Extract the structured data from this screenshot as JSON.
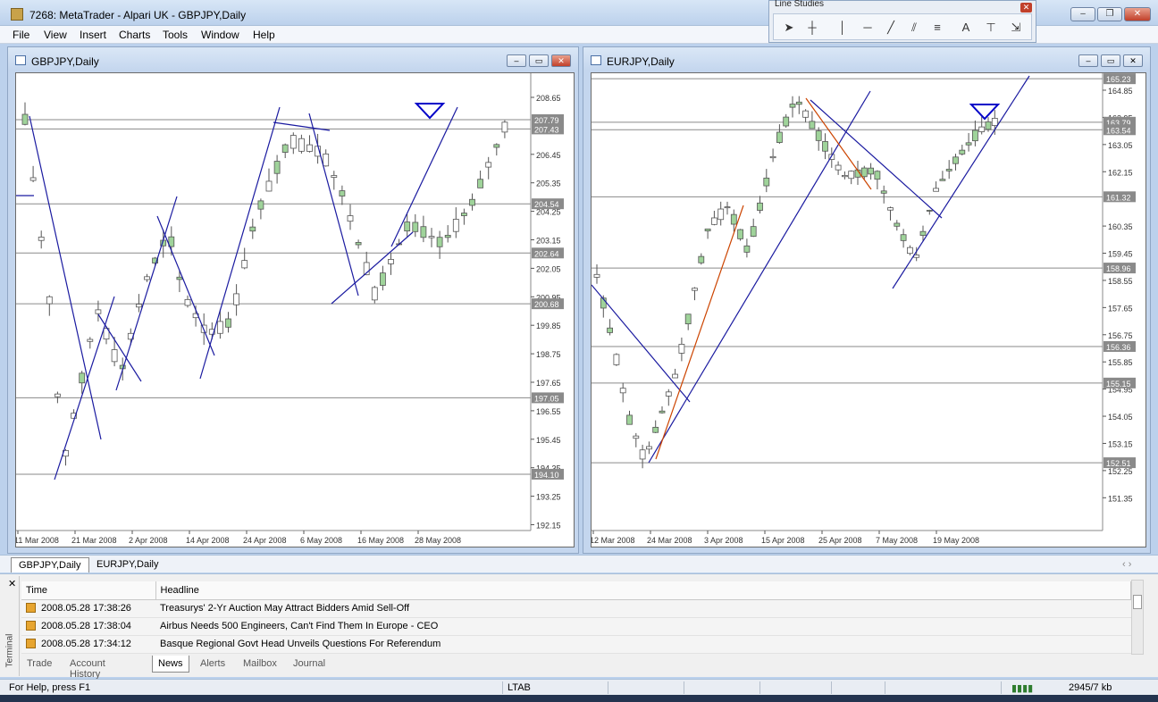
{
  "window": {
    "title": "7268: MetaTrader - Alpari UK - GBPJPY,Daily"
  },
  "menu": [
    "File",
    "View",
    "Insert",
    "Charts",
    "Tools",
    "Window",
    "Help"
  ],
  "line_studies": {
    "title": "Line Studies",
    "tools": [
      "cursor-icon",
      "crosshair-icon",
      "vertical-line-icon",
      "horizontal-line-icon",
      "trendline-icon",
      "fibonacci-icon",
      "channel-icon",
      "text-icon",
      "text-label-icon",
      "arrows-icon"
    ]
  },
  "charts": {
    "gbp": {
      "title": "GBPJPY,Daily",
      "price_labels": [
        "208.65",
        "206.45",
        "205.35",
        "204.25",
        "203.15",
        "202.05",
        "200.95",
        "199.85",
        "198.75",
        "197.65",
        "196.55",
        "195.45",
        "194.35",
        "193.25",
        "192.15"
      ],
      "hline_labels": [
        "207.79",
        "207.43",
        "204.54",
        "202.64",
        "200.68",
        "197.05",
        "194.10"
      ],
      "date_labels": [
        "11 Mar 2008",
        "21 Mar 2008",
        "2 Apr 2008",
        "14 Apr 2008",
        "24 Apr 2008",
        "6 May 2008",
        "16 May 2008",
        "28 May 2008"
      ]
    },
    "eur": {
      "title": "EURJPY,Daily",
      "price_labels": [
        "164.85",
        "163.95",
        "163.05",
        "162.15",
        "160.35",
        "159.45",
        "158.55",
        "157.65",
        "156.75",
        "155.85",
        "154.95",
        "154.05",
        "153.15",
        "152.25",
        "151.35"
      ],
      "hline_labels": [
        "165.23",
        "163.79",
        "163.54",
        "161.32",
        "158.96",
        "156.36",
        "155.15",
        "152.51"
      ],
      "date_labels": [
        "12 Mar 2008",
        "24 Mar 2008",
        "3 Apr 2008",
        "15 Apr 2008",
        "25 Apr 2008",
        "7 May 2008",
        "19 May 2008"
      ]
    }
  },
  "chart_tabs": [
    "GBPJPY,Daily",
    "EURJPY,Daily"
  ],
  "terminal": {
    "side_label": "Terminal",
    "columns": [
      "Time",
      "Headline"
    ],
    "rows": [
      {
        "time": "2008.05.28 17:38:26",
        "headline": "Treasurys' 2-Yr Auction May Attract Bidders Amid Sell-Off"
      },
      {
        "time": "2008.05.28 17:38:04",
        "headline": "Airbus Needs 500 Engineers, Can't Find Them In Europe - CEO"
      },
      {
        "time": "2008.05.28 17:34:12",
        "headline": "Basque Regional Govt Head Unveils Questions For Referendum"
      }
    ],
    "tabs": [
      "Trade",
      "Account History",
      "News",
      "Alerts",
      "Mailbox",
      "Journal"
    ],
    "active_tab": "News"
  },
  "status": {
    "help": "For Help, press F1",
    "profile": "LTAB",
    "traffic": "2945/7 kb"
  }
}
